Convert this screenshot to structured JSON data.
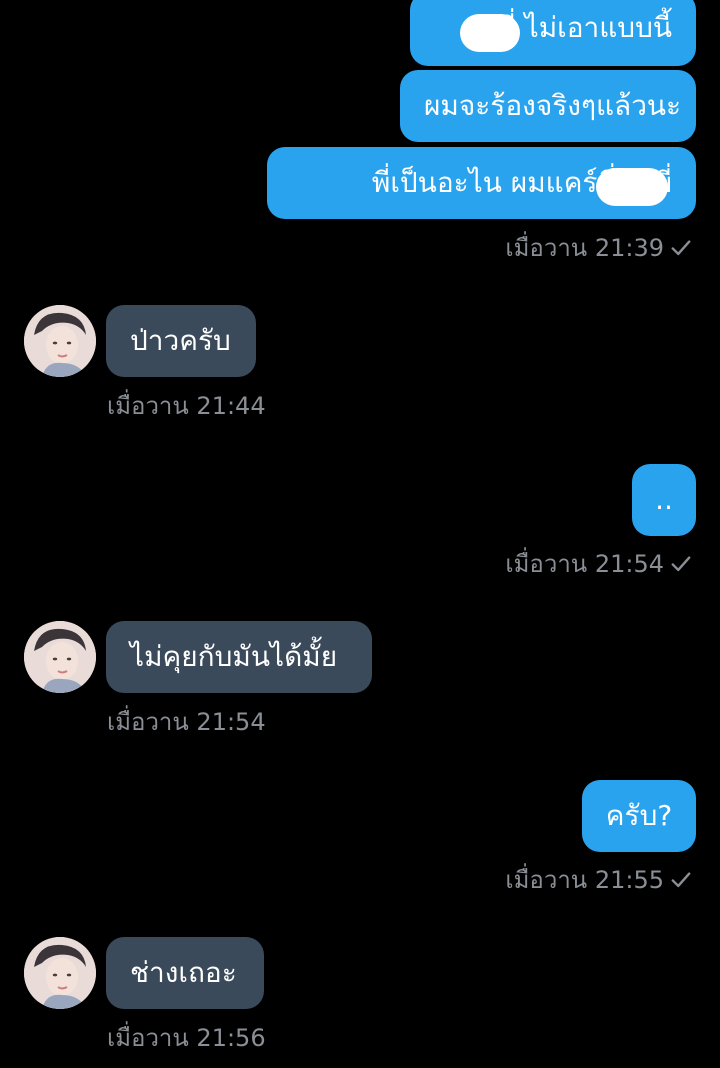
{
  "colors": {
    "background": "#000000",
    "outgoing_bubble": "#2aa3ef",
    "incoming_bubble": "#3a4a5a",
    "meta_text": "#8a8f96"
  },
  "messages": [
    {
      "direction": "out",
      "text": "พี่      ไม่เอาแบบนี้"
    },
    {
      "direction": "out",
      "text": "ผมจะร้องจริงๆแล้วนะ"
    },
    {
      "direction": "out",
      "text": "พี่เป็นอะไน ผมแคร์พี่นพพี่"
    },
    {
      "direction": "meta",
      "time": "เมื่อวาน 21:39",
      "status": "check-icon"
    },
    {
      "direction": "in",
      "text": "ป่าวครับ",
      "time": "เมื่อวาน 21:44"
    },
    {
      "direction": "out",
      "text": "..",
      "time": "เมื่อวาน 21:54",
      "status": "check-icon"
    },
    {
      "direction": "in",
      "text": "ไม่คุยกับมันได้มั้ย",
      "time": "เมื่อวาน 21:54"
    },
    {
      "direction": "out",
      "text": "ครับ?",
      "time": "เมื่อวาน 21:55",
      "status": "check-icon"
    },
    {
      "direction": "in",
      "text": "ช่างเถอะ",
      "time": "เมื่อวาน 21:56"
    }
  ]
}
